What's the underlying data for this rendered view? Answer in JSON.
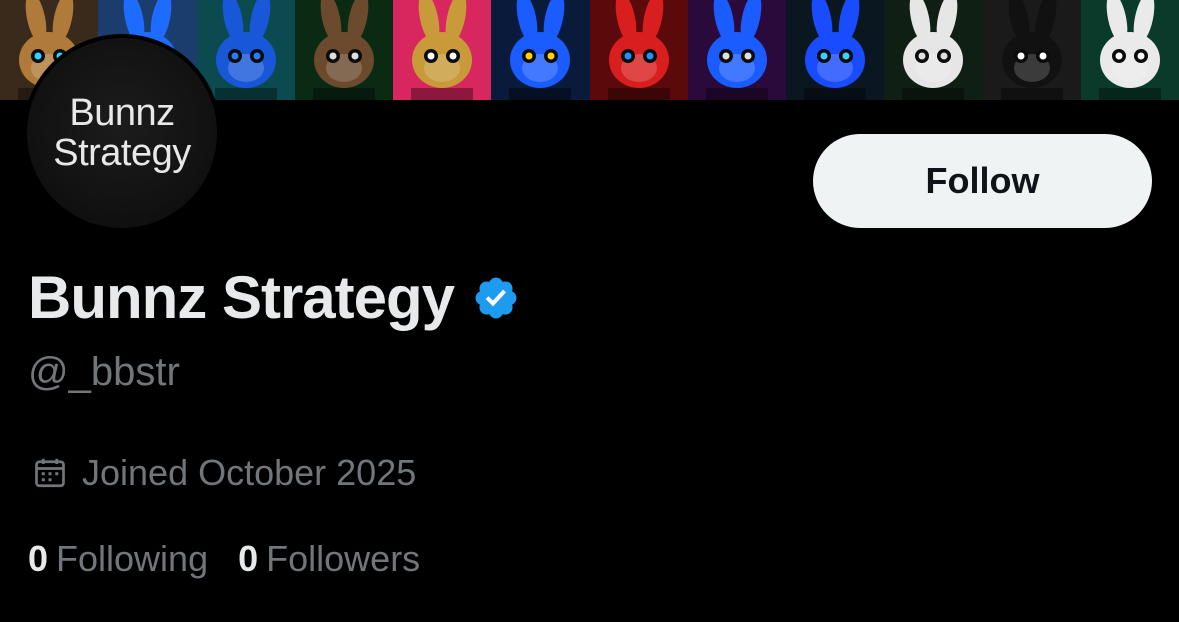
{
  "banner": {
    "tiles": [
      {
        "bg": "#3a2a1c",
        "ear": "#b07a3a",
        "eye": "#2dd4ff"
      },
      {
        "bg": "#1b3d6e",
        "ear": "#1e6cff",
        "eye": "#1e90ff"
      },
      {
        "bg": "#0b4a4f",
        "ear": "#1857d8",
        "eye": "#2a7bff"
      },
      {
        "bg": "#0a2a14",
        "ear": "#6b4a2e",
        "eye": "#e0e0e0"
      },
      {
        "bg": "#d8265f",
        "ear": "#c99a3a",
        "eye": "#ffffff"
      },
      {
        "bg": "#0a1a3a",
        "ear": "#1a5cff",
        "eye": "#ffd400"
      },
      {
        "bg": "#5a0a0a",
        "ear": "#d81e1e",
        "eye": "#1e90ff"
      },
      {
        "bg": "#2a0a3a",
        "ear": "#1a5cff",
        "eye": "#e0e0e0"
      },
      {
        "bg": "#0a1620",
        "ear": "#1a4cff",
        "eye": "#3ad0ff"
      },
      {
        "bg": "#0f1f14",
        "ear": "#e6e6e6",
        "eye": "#e0e0e0"
      },
      {
        "bg": "#1a1a1a",
        "ear": "#111111",
        "eye": "#ffffff"
      },
      {
        "bg": "#0a3a2a",
        "ear": "#eaeaea",
        "eye": "#ffffff"
      }
    ]
  },
  "avatar": {
    "line1": "Bunnz",
    "line2": "Strategy"
  },
  "follow_button": {
    "label": "Follow"
  },
  "profile": {
    "display_name": "Bunnz Strategy",
    "handle": "@_bbstr",
    "joined": "Joined October 2025",
    "following_count": "0",
    "following_label": "Following",
    "followers_count": "0",
    "followers_label": "Followers"
  },
  "colors": {
    "background": "#000000",
    "primary_text": "#e7e9ea",
    "secondary_text": "#71767b",
    "verified_badge": "#1d9bf0",
    "follow_button_bg": "#eff3f4"
  },
  "icons": {
    "verified": "verified-badge-icon",
    "calendar": "calendar-icon"
  }
}
